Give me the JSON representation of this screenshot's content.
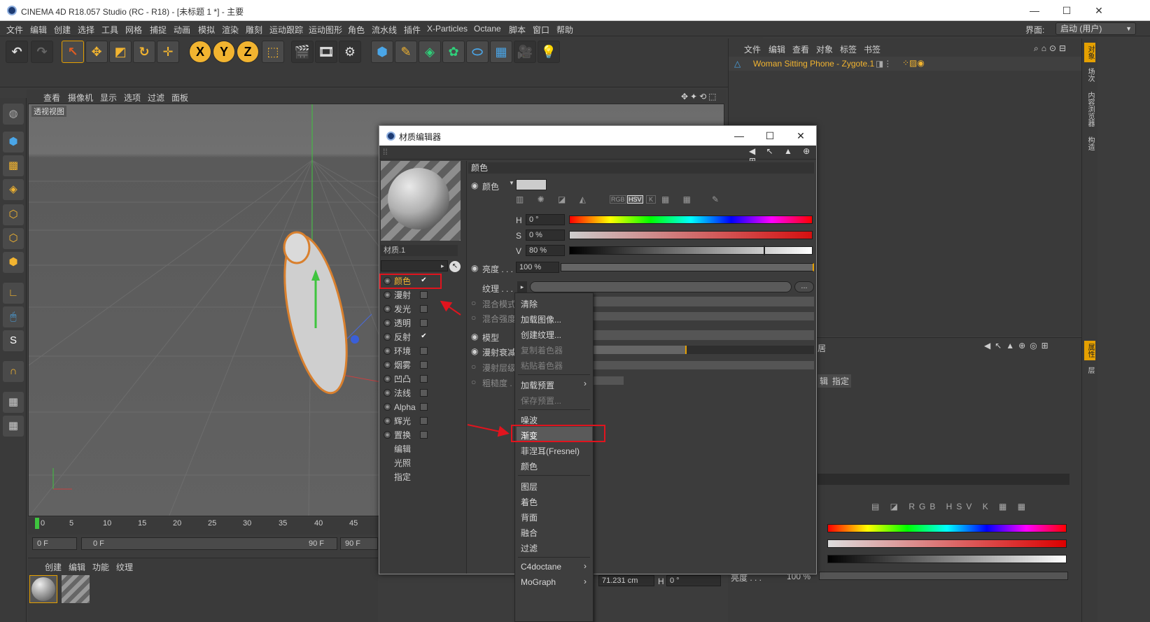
{
  "window": {
    "title": "CINEMA 4D R18.057 Studio (RC - R18) - [未标题 1 *] - 主要",
    "min": "—",
    "max": "☐",
    "close": "✕"
  },
  "menu": [
    "文件",
    "编辑",
    "创建",
    "选择",
    "工具",
    "网格",
    "捕捉",
    "动画",
    "模拟",
    "渲染",
    "雕刻",
    "运动跟踪",
    "运动图形",
    "角色",
    "流水线",
    "插件",
    "X-Particles",
    "Octane",
    "脚本",
    "窗口",
    "帮助"
  ],
  "layout": {
    "label": "界面:",
    "value": "启动 (用户)"
  },
  "viewport": {
    "menu": [
      "查看",
      "摄像机",
      "显示",
      "选项",
      "过滤",
      "面板"
    ],
    "label": "透视视图"
  },
  "timeline": {
    "ticks": [
      "0",
      "5",
      "10",
      "15",
      "20",
      "25",
      "30",
      "35",
      "40",
      "45"
    ],
    "start": "0 F",
    "range_start": "0 F",
    "range_end": "90 F",
    "end": "90 F"
  },
  "material_manager": {
    "menu": [
      "创建",
      "编辑",
      "功能",
      "纹理"
    ]
  },
  "object_manager": {
    "menu": [
      "文件",
      "编辑",
      "查看",
      "对象",
      "标签",
      "书签"
    ],
    "object_name": "Woman Sitting Phone - Zygote.1"
  },
  "right_strip": [
    "对象",
    "场次",
    "内容浏览器",
    "构造",
    "属性",
    "层"
  ],
  "attributes": {
    "tabs": [
      "辑",
      "指定"
    ],
    "coord_value": "71.231 cm",
    "h_label": "H",
    "h_value": "0 °",
    "brightness_label": "亮度 . . .",
    "brightness_value": "100 %"
  },
  "dialog": {
    "title": "材质编辑器",
    "material_name": "材质.1",
    "channels": [
      {
        "label": "颜色",
        "checked": true
      },
      {
        "label": "漫射",
        "checked": false
      },
      {
        "label": "发光",
        "checked": false
      },
      {
        "label": "透明",
        "checked": false
      },
      {
        "label": "反射",
        "checked": true
      },
      {
        "label": "环境",
        "checked": false
      },
      {
        "label": "烟雾",
        "checked": false
      },
      {
        "label": "凹凸",
        "checked": false
      },
      {
        "label": "法线",
        "checked": false
      },
      {
        "label": "Alpha",
        "checked": false
      },
      {
        "label": "辉光",
        "checked": false
      },
      {
        "label": "置换",
        "checked": false
      }
    ],
    "extra": [
      "编辑",
      "光照",
      "指定"
    ],
    "section": "颜色",
    "color_label": "颜色",
    "h": {
      "label": "H",
      "value": "0 °"
    },
    "s": {
      "label": "S",
      "value": "0 %"
    },
    "v": {
      "label": "V",
      "value": "80 %",
      "level": 0.8
    },
    "brightness": {
      "label": "亮度 . . .",
      "value": "100 %"
    },
    "texture_label": "纹理 . . .",
    "texture_btn": "...",
    "blend_mode": "混合模式",
    "blend_strength": "混合强度",
    "model": "模型",
    "diffuse_falloff": "漫射衰减",
    "diffuse_level": "漫射层级",
    "roughness": "粗糙度 . . .",
    "mode_icons": [
      "RGB",
      "HSV",
      "K"
    ]
  },
  "context_menu": {
    "items": [
      "清除",
      "加载图像...",
      "创建纹理...",
      "复制着色器",
      "粘贴着色器",
      "加载预置",
      "保存预置...",
      "噪波",
      "渐变",
      "菲涅耳(Fresnel)",
      "颜色",
      "图层",
      "着色",
      "背面",
      "融合",
      "过滤",
      "C4doctane",
      "MoGraph"
    ],
    "disabled": [
      "复制着色器",
      "粘贴着色器",
      "保存预置..."
    ],
    "submenu_arrow": "›"
  }
}
